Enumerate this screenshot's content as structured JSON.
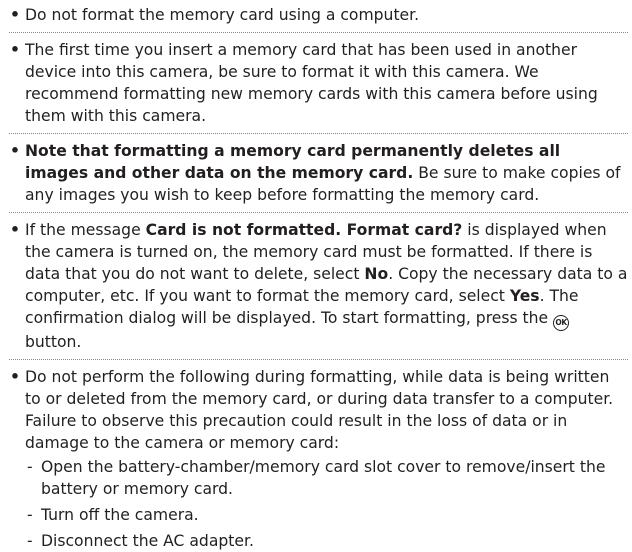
{
  "bullet_char": "•",
  "dash_char": "-",
  "ok_label": "OK",
  "items": [
    {
      "text": "Do not format the memory card using a computer."
    },
    {
      "text": "The first time you insert a memory card that has been used in another device into this camera, be sure to format it with this camera. We recommend formatting new memory cards with this camera before using them with this camera."
    },
    {
      "bold": "Note that formatting a memory card permanently deletes all images and other data on the memory card.",
      "text": " Be sure to make copies of any images you wish to keep before formatting the memory card."
    },
    {
      "t1": "If the message ",
      "b1": "Card is not formatted. Format card?",
      "t2": " is displayed when the camera is turned on, the memory card must be formatted. If there is data that you do not want to delete, select ",
      "b2": "No",
      "t3": ". Copy the necessary data to a computer, etc. If you want to format the memory card, select ",
      "b3": "Yes",
      "t4": ". The confirmation dialog will be displayed. To start formatting, press the ",
      "t5": " button."
    },
    {
      "text": "Do not perform the following during formatting, while data is being written to or deleted from the memory card, or during data transfer to a computer. Failure to observe this precaution could result in the loss of data or in damage to the camera or memory card:",
      "sub": [
        "Open the battery-chamber/memory card slot cover to remove/insert the battery or memory card.",
        "Turn off the camera.",
        "Disconnect the AC adapter."
      ]
    }
  ]
}
